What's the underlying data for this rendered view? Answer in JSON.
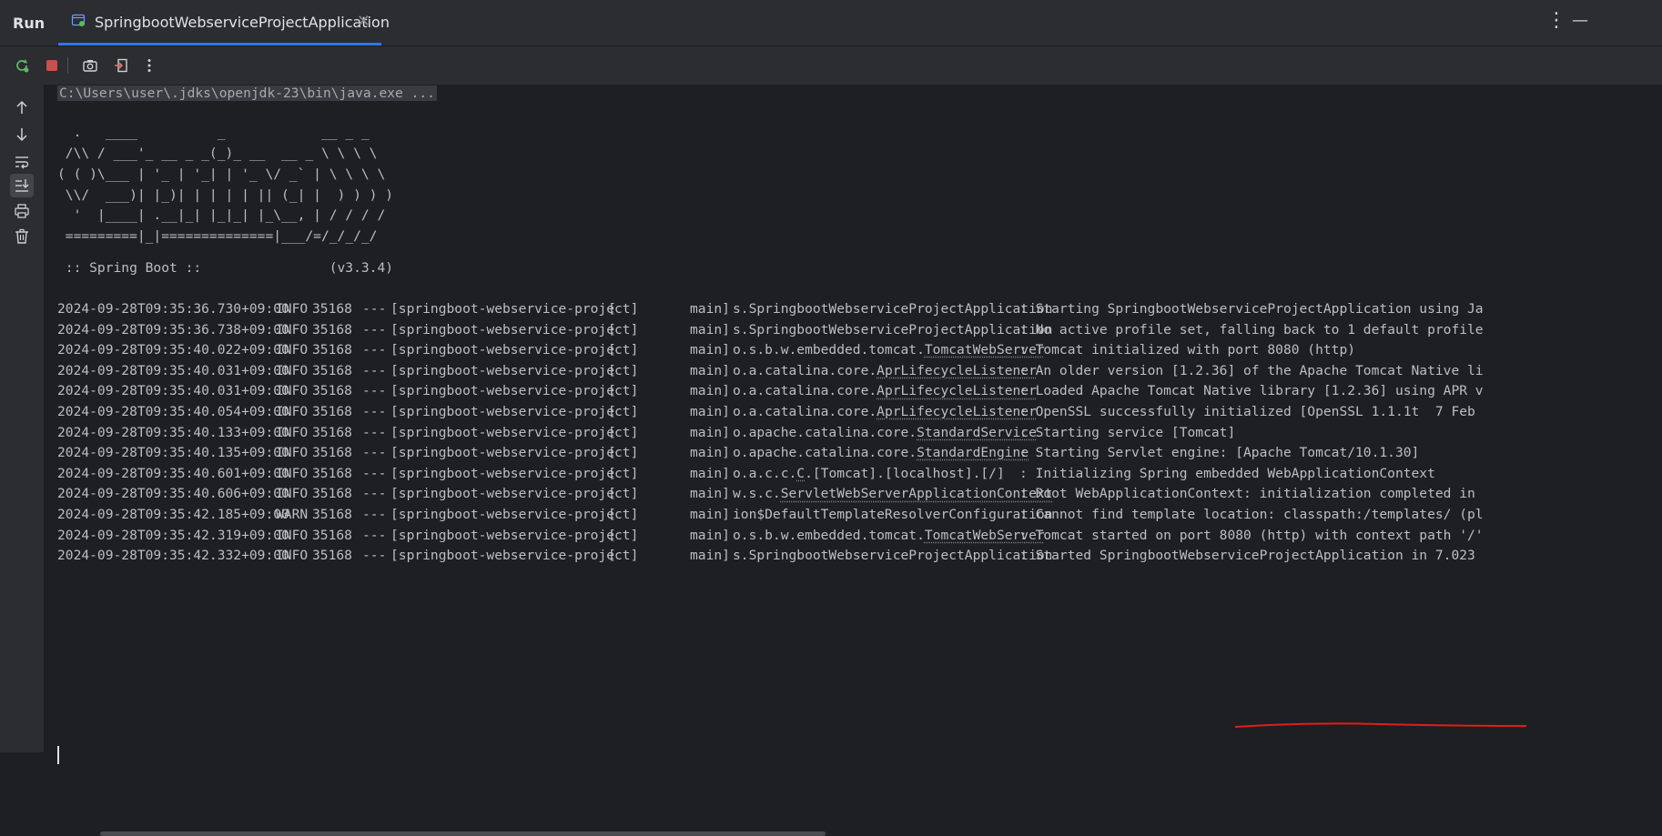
{
  "header": {
    "run_label": "Run",
    "tab_title": "SpringbootWebserviceProjectApplication",
    "close_glyph": "✕",
    "more_glyph": "⋮",
    "minimize_glyph": "—"
  },
  "toolbar": {
    "icons": [
      "rerun-icon",
      "stop-icon",
      "camera-icon",
      "exit-icon",
      "more-icon"
    ]
  },
  "gutter": {
    "icons": [
      "scroll-up-icon",
      "scroll-down-icon",
      "soft-wrap-icon",
      "scroll-to-end-icon",
      "print-icon",
      "clear-icon"
    ]
  },
  "console": {
    "command": "C:\\Users\\user\\.jdks\\openjdk-23\\bin\\java.exe ...",
    "banner": [
      "  .   ____          _            __ _ _",
      " /\\\\ / ___'_ __ _ _(_)_ __  __ _ \\ \\ \\ \\",
      "( ( )\\___ | '_ | '_| | '_ \\/ _` | \\ \\ \\ \\",
      " \\\\/  ___)| |_)| | | | | || (_| |  ) ) ) )",
      "  '  |____| .__|_| |_|_| |_\\__, | / / / /",
      " =========|_|==============|___/=/_/_/_/"
    ],
    "version_line": " :: Spring Boot ::                (v3.3.4)",
    "log_lines": [
      {
        "ts": "2024-09-28T09:35:36.730+09:00",
        "level": "INFO",
        "pid": "35168",
        "sep": "---",
        "app": "[springboot-webservice-project]",
        "bracket": "[",
        "thread": "main]",
        "logger_pre": "s.SpringbootWebserviceProjectApplication",
        "logger_ul": "",
        "logger_post": "",
        "msg": ": Starting SpringbootWebserviceProjectApplication using Ja"
      },
      {
        "ts": "2024-09-28T09:35:36.738+09:00",
        "level": "INFO",
        "pid": "35168",
        "sep": "---",
        "app": "[springboot-webservice-project]",
        "bracket": "[",
        "thread": "main]",
        "logger_pre": "s.SpringbootWebserviceProjectApplication",
        "logger_ul": "",
        "logger_post": "",
        "msg": ": No active profile set, falling back to 1 default profile"
      },
      {
        "ts": "2024-09-28T09:35:40.022+09:00",
        "level": "INFO",
        "pid": "35168",
        "sep": "---",
        "app": "[springboot-webservice-project]",
        "bracket": "[",
        "thread": "main]",
        "logger_pre": "o.s.b.w.embedded.tomcat.",
        "logger_ul": "TomcatWebServer",
        "logger_post": "",
        "msg": ": Tomcat initialized with port 8080 (http)"
      },
      {
        "ts": "2024-09-28T09:35:40.031+09:00",
        "level": "INFO",
        "pid": "35168",
        "sep": "---",
        "app": "[springboot-webservice-project]",
        "bracket": "[",
        "thread": "main]",
        "logger_pre": "o.a.catalina.core.",
        "logger_ul": "AprLifecycleListener",
        "logger_post": "",
        "msg": ": An older version [1.2.36] of the Apache Tomcat Native li"
      },
      {
        "ts": "2024-09-28T09:35:40.031+09:00",
        "level": "INFO",
        "pid": "35168",
        "sep": "---",
        "app": "[springboot-webservice-project]",
        "bracket": "[",
        "thread": "main]",
        "logger_pre": "o.a.catalina.core.",
        "logger_ul": "AprLifecycleListener",
        "logger_post": "",
        "msg": ": Loaded Apache Tomcat Native library [1.2.36] using APR v"
      },
      {
        "ts": "2024-09-28T09:35:40.054+09:00",
        "level": "INFO",
        "pid": "35168",
        "sep": "---",
        "app": "[springboot-webservice-project]",
        "bracket": "[",
        "thread": "main]",
        "logger_pre": "o.a.catalina.core.",
        "logger_ul": "AprLifecycleListener",
        "logger_post": "",
        "msg": ": OpenSSL successfully initialized [OpenSSL 1.1.1t  7 Feb"
      },
      {
        "ts": "2024-09-28T09:35:40.133+09:00",
        "level": "INFO",
        "pid": "35168",
        "sep": "---",
        "app": "[springboot-webservice-project]",
        "bracket": "[",
        "thread": "main]",
        "logger_pre": "o.apache.catalina.core.",
        "logger_ul": "StandardService",
        "logger_post": "",
        "msg": ": Starting service [Tomcat]"
      },
      {
        "ts": "2024-09-28T09:35:40.135+09:00",
        "level": "INFO",
        "pid": "35168",
        "sep": "---",
        "app": "[springboot-webservice-project]",
        "bracket": "[",
        "thread": "main]",
        "logger_pre": "o.apache.catalina.core.",
        "logger_ul": "StandardEngine",
        "logger_post": "",
        "msg": ": Starting Servlet engine: [Apache Tomcat/10.1.30]"
      },
      {
        "ts": "2024-09-28T09:35:40.601+09:00",
        "level": "INFO",
        "pid": "35168",
        "sep": "---",
        "app": "[springboot-webservice-project]",
        "bracket": "[",
        "thread": "main]",
        "logger_pre": "o.a.c.c.",
        "logger_ul": "C",
        "logger_post": ".[Tomcat].[localhost].[/]",
        "msg": ": Initializing Spring embedded WebApplicationContext"
      },
      {
        "ts": "2024-09-28T09:35:40.606+09:00",
        "level": "INFO",
        "pid": "35168",
        "sep": "---",
        "app": "[springboot-webservice-project]",
        "bracket": "[",
        "thread": "main]",
        "logger_pre": "w.s.c.",
        "logger_ul": "ServletWebServerApplicationContext",
        "logger_post": "",
        "msg": ": Root WebApplicationContext: initialization completed in"
      },
      {
        "ts": "2024-09-28T09:35:42.185+09:00",
        "level": "WARN",
        "pid": "35168",
        "sep": "---",
        "app": "[springboot-webservice-project]",
        "bracket": "[",
        "thread": "main]",
        "logger_pre": "ion$DefaultTemplateResolverConfiguration",
        "logger_ul": "",
        "logger_post": "",
        "msg": ": Cannot find template location: classpath:/templates/ (pl"
      },
      {
        "ts": "2024-09-28T09:35:42.319+09:00",
        "level": "INFO",
        "pid": "35168",
        "sep": "---",
        "app": "[springboot-webservice-project]",
        "bracket": "[",
        "thread": "main]",
        "logger_pre": "o.s.b.w.embedded.tomcat.",
        "logger_ul": "TomcatWebServer",
        "logger_post": "",
        "msg": ": Tomcat started on port 8080 (http) with context path '/'"
      },
      {
        "ts": "2024-09-28T09:35:42.332+09:00",
        "level": "INFO",
        "pid": "35168",
        "sep": "---",
        "app": "[springboot-webservice-project]",
        "bracket": "[",
        "thread": "main]",
        "logger_pre": "s.SpringbootWebserviceProjectApplication",
        "logger_ul": "",
        "logger_post": "",
        "msg": ": Started SpringbootWebserviceProjectApplication in 7.023"
      }
    ]
  },
  "colors": {
    "accent": "#3574f0",
    "stop_red": "#c94f4f",
    "rerun_green": "#5fb865",
    "annotation_red": "#e01e1e"
  }
}
